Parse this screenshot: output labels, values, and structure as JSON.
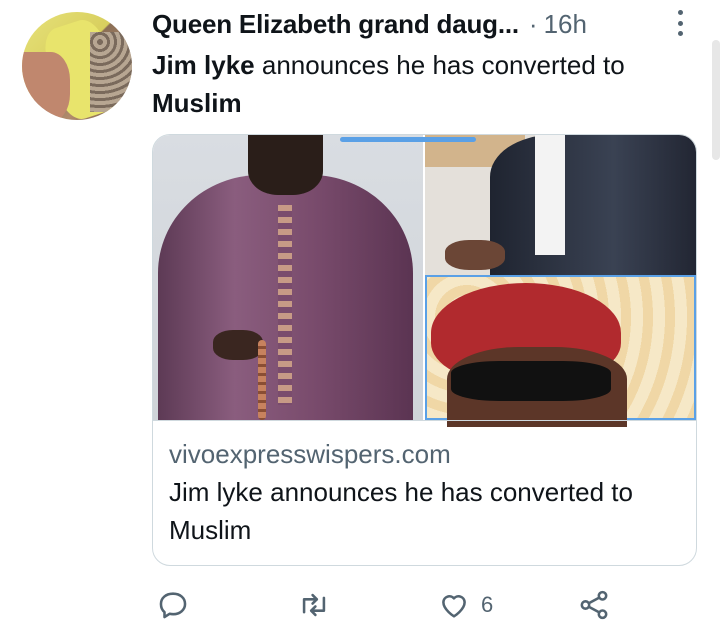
{
  "author": {
    "name": "Queen Elizabeth grand daug...",
    "separator": "·",
    "time": "16h"
  },
  "tweet": {
    "text_bold_1": "Jim lyke",
    "text_mid": " announces he has converted to ",
    "text_bold_2": "Muslim"
  },
  "card": {
    "domain": "vivoexpresswispers.com",
    "title": "Jim lyke announces he has converted to Muslim"
  },
  "actions": {
    "reply_icon": "reply-icon",
    "retweet_icon": "retweet-icon",
    "like_icon": "heart-icon",
    "like_count": "6",
    "share_icon": "share-icon"
  },
  "colors": {
    "secondary_text": "#536471",
    "border": "#cfd9de",
    "selection": "#5aa0e6"
  }
}
